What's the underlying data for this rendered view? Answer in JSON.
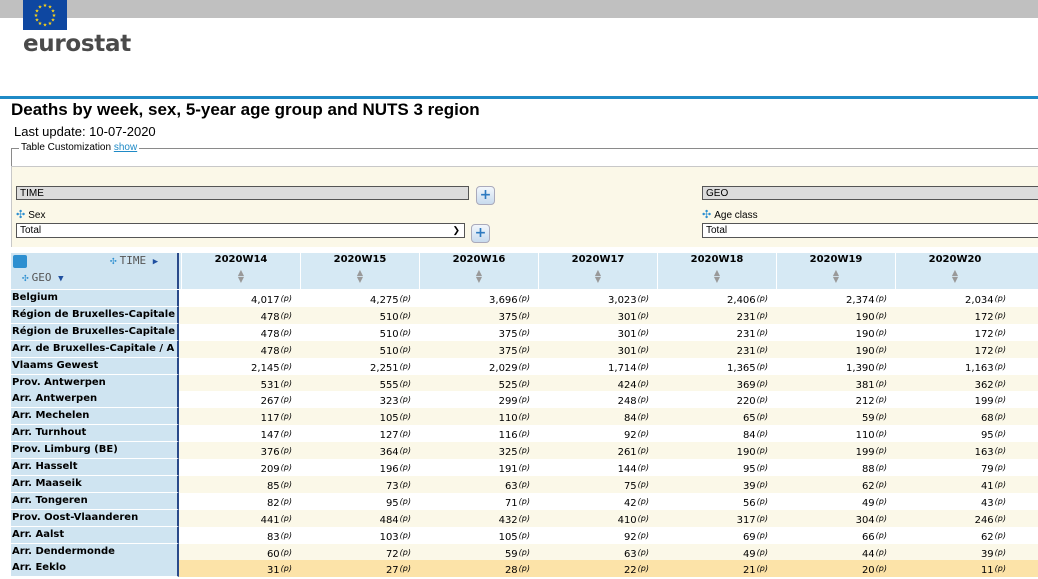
{
  "logo": {
    "text": "eurostat"
  },
  "page": {
    "title": "Deaths by week, sex, 5-year age group and NUTS 3 region",
    "last_update": "Last update: 10-07-2020"
  },
  "customization": {
    "label": "Table Customization",
    "link": "show"
  },
  "dimensions": {
    "time_label": "TIME",
    "geo_label": "GEO",
    "sex_label": "Sex",
    "sex_value": "Total",
    "age_label": "Age class",
    "age_value": "Total"
  },
  "table": {
    "time_axis": "TIME",
    "geo_axis": "GEO",
    "flag": "(p)",
    "columns": [
      "2020W14",
      "2020W15",
      "2020W16",
      "2020W17",
      "2020W18",
      "2020W19",
      "2020W20"
    ],
    "rows": [
      {
        "label": "Belgium",
        "values": [
          "4,017",
          "4,275",
          "3,696",
          "3,023",
          "2,406",
          "2,374",
          "2,034"
        ]
      },
      {
        "label": "Région de Bruxelles-Capitale",
        "values": [
          "478",
          "510",
          "375",
          "301",
          "231",
          "190",
          "172"
        ]
      },
      {
        "label": "Région de Bruxelles-Capitale",
        "values": [
          "478",
          "510",
          "375",
          "301",
          "231",
          "190",
          "172"
        ]
      },
      {
        "label": "Arr. de Bruxelles-Capitale / A",
        "values": [
          "478",
          "510",
          "375",
          "301",
          "231",
          "190",
          "172"
        ]
      },
      {
        "label": "Vlaams Gewest",
        "values": [
          "2,145",
          "2,251",
          "2,029",
          "1,714",
          "1,365",
          "1,390",
          "1,163"
        ]
      },
      {
        "label": "Prov. Antwerpen",
        "values": [
          "531",
          "555",
          "525",
          "424",
          "369",
          "381",
          "362"
        ]
      },
      {
        "label": "Arr. Antwerpen",
        "values": [
          "267",
          "323",
          "299",
          "248",
          "220",
          "212",
          "199"
        ]
      },
      {
        "label": "Arr. Mechelen",
        "values": [
          "117",
          "105",
          "110",
          "84",
          "65",
          "59",
          "68"
        ]
      },
      {
        "label": "Arr. Turnhout",
        "values": [
          "147",
          "127",
          "116",
          "92",
          "84",
          "110",
          "95"
        ]
      },
      {
        "label": "Prov. Limburg (BE)",
        "values": [
          "376",
          "364",
          "325",
          "261",
          "190",
          "199",
          "163"
        ]
      },
      {
        "label": "Arr. Hasselt",
        "values": [
          "209",
          "196",
          "191",
          "144",
          "95",
          "88",
          "79"
        ]
      },
      {
        "label": "Arr. Maaseik",
        "values": [
          "85",
          "73",
          "63",
          "75",
          "39",
          "62",
          "41"
        ]
      },
      {
        "label": "Arr. Tongeren",
        "values": [
          "82",
          "95",
          "71",
          "42",
          "56",
          "49",
          "43"
        ]
      },
      {
        "label": "Prov. Oost-Vlaanderen",
        "values": [
          "441",
          "484",
          "432",
          "410",
          "317",
          "304",
          "246"
        ]
      },
      {
        "label": "Arr. Aalst",
        "values": [
          "83",
          "103",
          "105",
          "92",
          "69",
          "66",
          "62"
        ]
      },
      {
        "label": "Arr. Dendermonde",
        "values": [
          "60",
          "72",
          "59",
          "63",
          "49",
          "44",
          "39"
        ]
      },
      {
        "label": "Arr. Eeklo",
        "values": [
          "31",
          "27",
          "28",
          "22",
          "21",
          "20",
          "11"
        ]
      }
    ]
  },
  "colors": {
    "row_even": "#ffffff",
    "row_odd": "#fbf8e8",
    "row_highlight": "#fce3a8",
    "header_blue": "#d6e9f4",
    "accent": "#1f8ac6"
  }
}
